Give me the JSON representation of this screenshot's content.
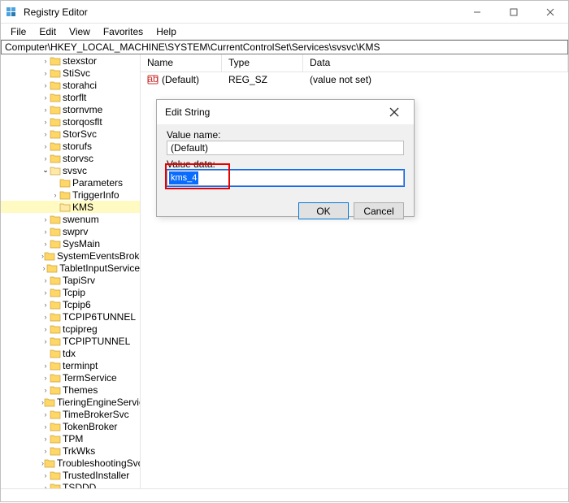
{
  "window": {
    "title": "Registry Editor"
  },
  "menu": {
    "file": "File",
    "edit": "Edit",
    "view": "View",
    "favorites": "Favorites",
    "help": "Help"
  },
  "address": "Computer\\HKEY_LOCAL_MACHINE\\SYSTEM\\CurrentControlSet\\Services\\svsvc\\KMS",
  "tree": {
    "items": [
      {
        "label": "stexstor",
        "expand": ">"
      },
      {
        "label": "StiSvc",
        "expand": ">"
      },
      {
        "label": "storahci",
        "expand": ">"
      },
      {
        "label": "storflt",
        "expand": ">"
      },
      {
        "label": "stornvme",
        "expand": ">"
      },
      {
        "label": "storqosflt",
        "expand": ">"
      },
      {
        "label": "StorSvc",
        "expand": ">"
      },
      {
        "label": "storufs",
        "expand": ">"
      },
      {
        "label": "storvsc",
        "expand": ">"
      },
      {
        "label": "svsvc",
        "expand": "v",
        "open": true
      },
      {
        "label": "Parameters",
        "expand": "",
        "indent": true
      },
      {
        "label": "TriggerInfo",
        "expand": ">",
        "indent": true
      },
      {
        "label": "KMS",
        "expand": "",
        "indent": true,
        "highlight": true
      },
      {
        "label": "swenum",
        "expand": ">"
      },
      {
        "label": "swprv",
        "expand": ">"
      },
      {
        "label": "SysMain",
        "expand": ">"
      },
      {
        "label": "SystemEventsBroker",
        "expand": ">"
      },
      {
        "label": "TabletInputService",
        "expand": ">"
      },
      {
        "label": "TapiSrv",
        "expand": ">"
      },
      {
        "label": "Tcpip",
        "expand": ">"
      },
      {
        "label": "Tcpip6",
        "expand": ">"
      },
      {
        "label": "TCPIP6TUNNEL",
        "expand": ">"
      },
      {
        "label": "tcpipreg",
        "expand": ">"
      },
      {
        "label": "TCPIPTUNNEL",
        "expand": ">"
      },
      {
        "label": "tdx",
        "expand": ""
      },
      {
        "label": "terminpt",
        "expand": ">"
      },
      {
        "label": "TermService",
        "expand": ">"
      },
      {
        "label": "Themes",
        "expand": ">"
      },
      {
        "label": "TieringEngineService",
        "expand": ">"
      },
      {
        "label": "TimeBrokerSvc",
        "expand": ">"
      },
      {
        "label": "TokenBroker",
        "expand": ">"
      },
      {
        "label": "TPM",
        "expand": ">"
      },
      {
        "label": "TrkWks",
        "expand": ">"
      },
      {
        "label": "TroubleshootingSvc",
        "expand": ">"
      },
      {
        "label": "TrustedInstaller",
        "expand": ">"
      },
      {
        "label": "TSDDD",
        "expand": ">"
      }
    ]
  },
  "list": {
    "headers": {
      "name": "Name",
      "type": "Type",
      "data": "Data"
    },
    "rows": [
      {
        "name": "(Default)",
        "type": "REG_SZ",
        "data": "(value not set)"
      }
    ]
  },
  "dialog": {
    "title": "Edit String",
    "value_name_label": "Value name:",
    "value_name": "(Default)",
    "value_data_label": "Value data:",
    "value_data": "kms_4",
    "ok": "OK",
    "cancel": "Cancel"
  }
}
